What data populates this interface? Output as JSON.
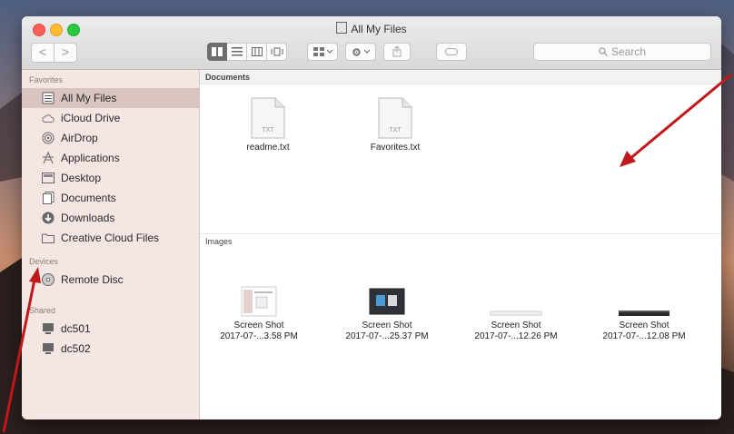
{
  "window": {
    "title": "All My Files"
  },
  "toolbar": {
    "back_glyph": "<",
    "forward_glyph": ">",
    "search_placeholder": "Search"
  },
  "sidebar": {
    "favorites_header": "Favorites",
    "favorites": [
      {
        "label": "All My Files",
        "icon": "all-my-files-icon",
        "selected": true
      },
      {
        "label": "iCloud Drive",
        "icon": "cloud-icon",
        "selected": false
      },
      {
        "label": "AirDrop",
        "icon": "airdrop-icon",
        "selected": false
      },
      {
        "label": "Applications",
        "icon": "applications-icon",
        "selected": false
      },
      {
        "label": "Desktop",
        "icon": "desktop-icon",
        "selected": false
      },
      {
        "label": "Documents",
        "icon": "documents-icon",
        "selected": false
      },
      {
        "label": "Downloads",
        "icon": "downloads-icon",
        "selected": false
      },
      {
        "label": "Creative Cloud Files",
        "icon": "folder-icon",
        "selected": false
      }
    ],
    "devices_header": "Devices",
    "devices": [
      {
        "label": "Remote Disc",
        "icon": "disc-icon"
      }
    ],
    "shared_header": "Shared",
    "shared": [
      {
        "label": "dc501",
        "icon": "computer-icon"
      },
      {
        "label": "dc502",
        "icon": "computer-icon"
      }
    ]
  },
  "content": {
    "documents_header": "Documents",
    "documents": [
      {
        "name": "readme.txt",
        "ext": "TXT"
      },
      {
        "name": "Favorites.txt",
        "ext": "TXT"
      }
    ],
    "images_header": "Images",
    "images": [
      {
        "line1": "Screen Shot",
        "line2": "2017-07-...3.58 PM"
      },
      {
        "line1": "Screen Shot",
        "line2": "2017-07-...25.37 PM"
      },
      {
        "line1": "Screen Shot",
        "line2": "2017-07-...12.26 PM"
      },
      {
        "line1": "Screen Shot",
        "line2": "2017-07-...12.08 PM"
      }
    ]
  },
  "colors": {
    "annotation_arrow": "#c0171b",
    "sidebar_selection": "#d9c4c0",
    "active_view_button": "#6d6d6d"
  }
}
